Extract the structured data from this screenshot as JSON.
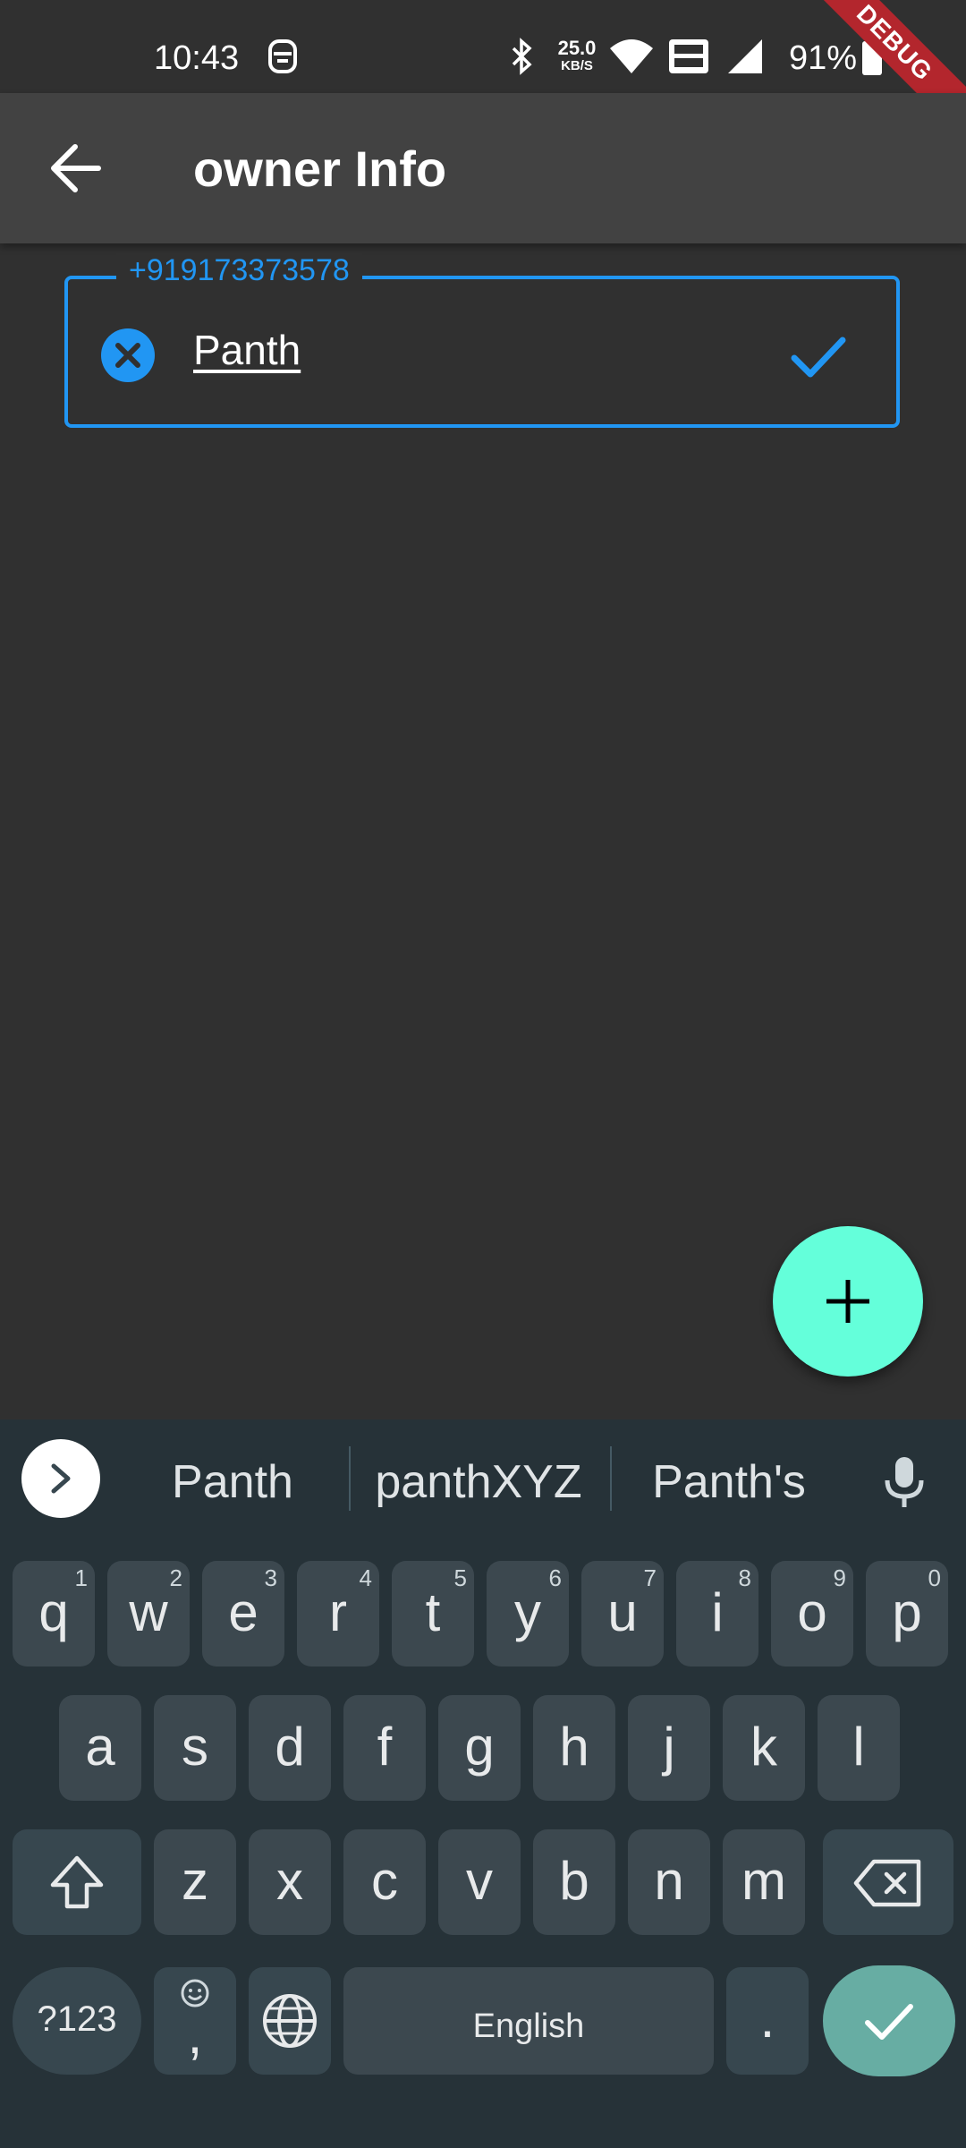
{
  "status_bar": {
    "time": "10:43",
    "net_speed_value": "25.0",
    "net_speed_unit": "KB/S",
    "battery": "91%",
    "debug_label": "DEBUG"
  },
  "app_bar": {
    "title": "owner Info"
  },
  "field": {
    "label": "+919173373578",
    "value": "Panth"
  },
  "keyboard": {
    "suggestions": [
      "Panth",
      "panthXYZ",
      "Panth's"
    ],
    "row1": [
      {
        "k": "q",
        "h": "1"
      },
      {
        "k": "w",
        "h": "2"
      },
      {
        "k": "e",
        "h": "3"
      },
      {
        "k": "r",
        "h": "4"
      },
      {
        "k": "t",
        "h": "5"
      },
      {
        "k": "y",
        "h": "6"
      },
      {
        "k": "u",
        "h": "7"
      },
      {
        "k": "i",
        "h": "8"
      },
      {
        "k": "o",
        "h": "9"
      },
      {
        "k": "p",
        "h": "0"
      }
    ],
    "row2": [
      "a",
      "s",
      "d",
      "f",
      "g",
      "h",
      "j",
      "k",
      "l"
    ],
    "row3": [
      "z",
      "x",
      "c",
      "v",
      "b",
      "n",
      "m"
    ],
    "symbols_label": "?123",
    "comma_label": ",",
    "space_label": "English",
    "period_label": "."
  },
  "colors": {
    "accent": "#2196f3",
    "fab": "#64ffda",
    "background": "#303030",
    "app_bar": "#424242",
    "keyboard": "#263238",
    "debug_banner": "#b3262d"
  }
}
